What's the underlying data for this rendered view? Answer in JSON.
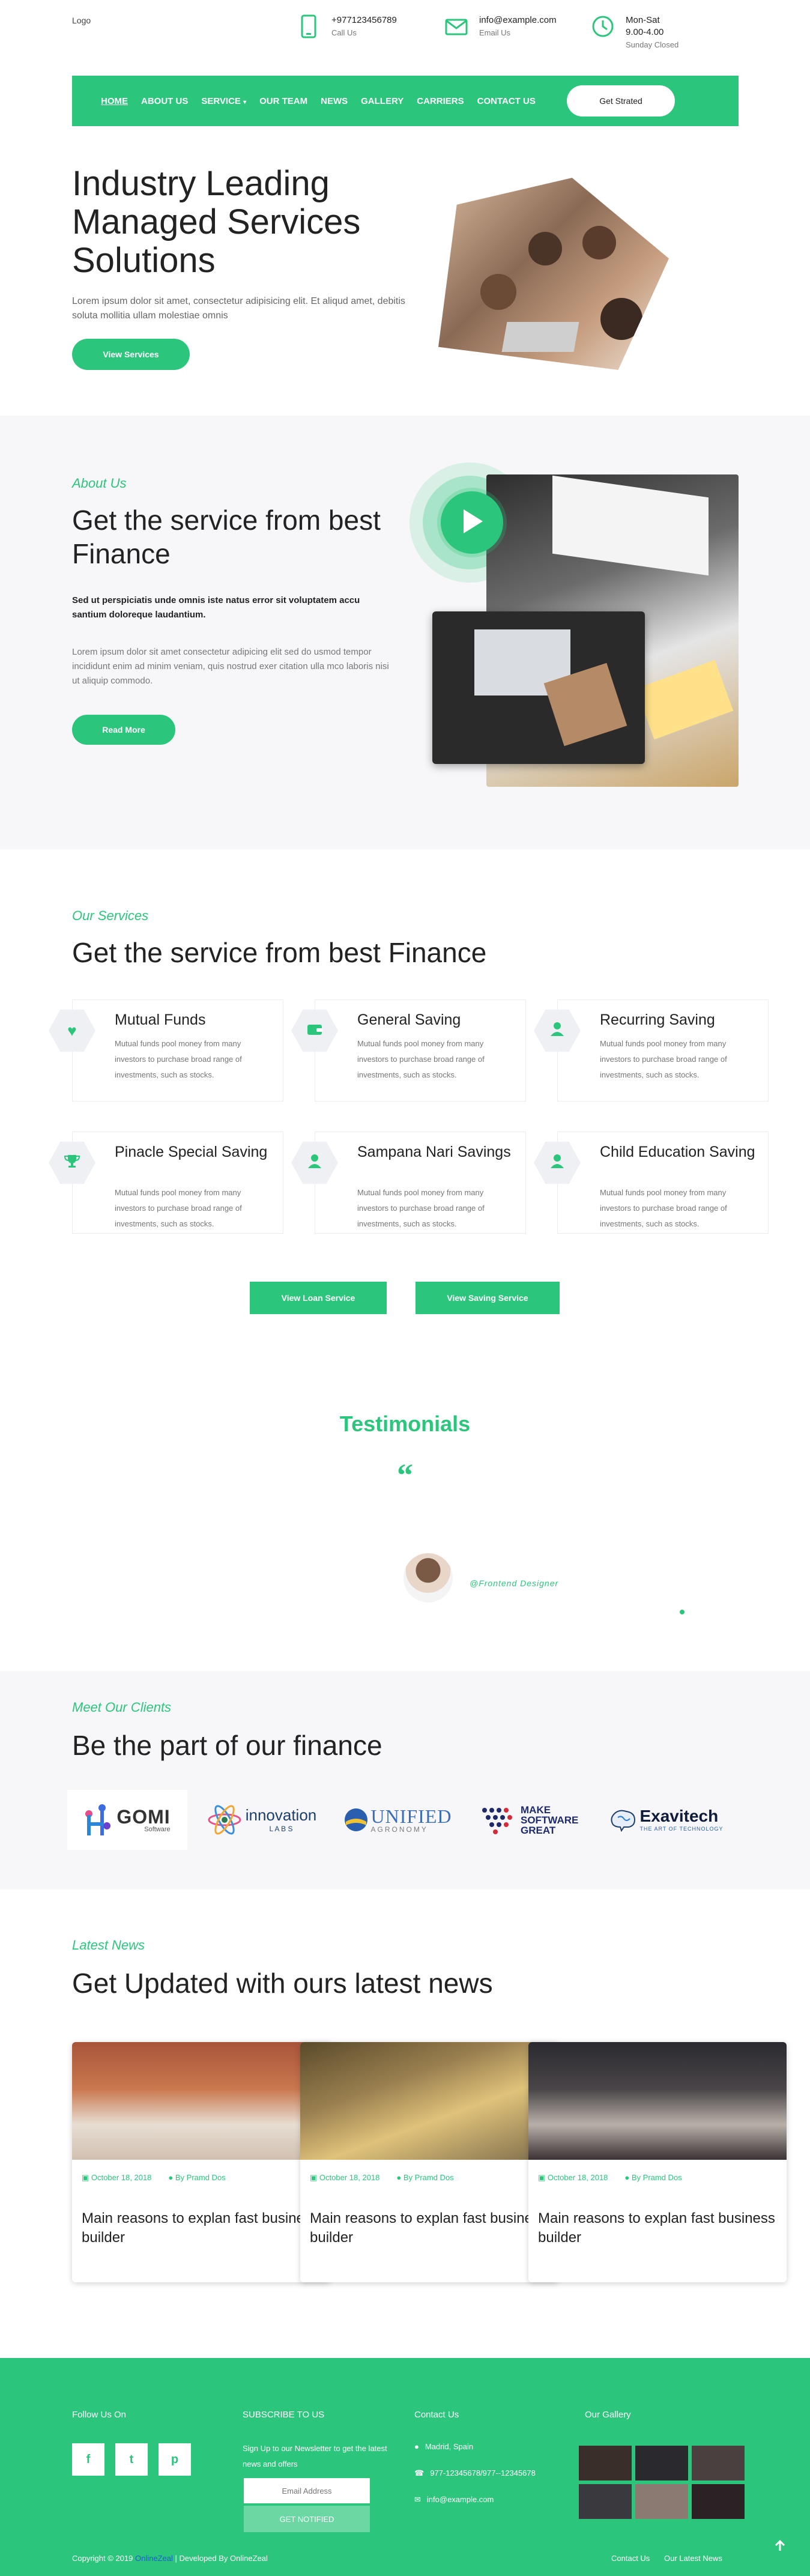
{
  "header": {
    "logo": "Logo",
    "phone": {
      "value": "+977123456789",
      "label": "Call Us"
    },
    "email": {
      "value": "info@example.com",
      "label": "Email Us"
    },
    "hours": {
      "days": "Mon-Sat",
      "time": "9.00-4.00",
      "note": "Sunday Closed"
    }
  },
  "nav": {
    "items": [
      "HOME",
      "ABOUT US",
      "SERVICE",
      "OUR TEAM",
      "NEWS",
      "GALLERY",
      "CARRIERS",
      "CONTACT US"
    ],
    "cta": "Get Strated"
  },
  "hero": {
    "title": "Industry Leading Managed Services Solutions",
    "text": "Lorem ipsum dolor sit amet, consectetur adipisicing elit. Et aliqud amet, debitis soluta mollitia ullam molestiae omnis",
    "button": "View Services"
  },
  "about": {
    "eyebrow": "About Us",
    "title": "Get the service from best Finance",
    "bold_text": "Sed ut perspiciatis unde omnis iste natus error sit voluptatem accu santium doloreque laudantium.",
    "text": "Lorem ipsum dolor sit amet consectetur adipicing elit sed do usmod tempor incididunt enim ad minim veniam, quis nostrud exer citation ulla mco laboris nisi ut aliquip commodo.",
    "button": "Read More"
  },
  "services": {
    "eyebrow": "Our Services",
    "title": "Get the service from best Finance",
    "items": [
      {
        "title": "Mutual Funds",
        "desc": "Mutual funds pool money from many investors to purchase broad range of investments, such as stocks.",
        "icon": "heart-icon"
      },
      {
        "title": "General Saving",
        "desc": "Mutual funds pool money from many investors to purchase broad range of investments, such as stocks.",
        "icon": "wallet-icon"
      },
      {
        "title": "Recurring Saving",
        "desc": "Mutual funds pool money from many investors to purchase broad range of investments, such as stocks.",
        "icon": "user-icon"
      },
      {
        "title": "Pinacle Special Saving",
        "desc": "Mutual funds pool money from many investors to purchase broad range of investments, such as stocks.",
        "icon": "trophy-icon"
      },
      {
        "title": "Sampana Nari Savings",
        "desc": "Mutual funds pool money from many investors to purchase broad range of investments, such as stocks.",
        "icon": "user-icon"
      },
      {
        "title": "Child Education Saving",
        "desc": "Mutual funds pool money from many investors to purchase broad range of investments, such as stocks.",
        "icon": "user-icon"
      }
    ],
    "btn_loan": "View Loan Service",
    "btn_saving": "View Saving Service"
  },
  "testimonials": {
    "title": "Testimonials",
    "quote_mark": "“",
    "role": "@Frontend Designer"
  },
  "clients": {
    "eyebrow": "Meet Our Clients",
    "title": "Be the part of our finance",
    "logos": [
      {
        "name": "GOMI",
        "sub": "Software"
      },
      {
        "name": "innovation",
        "sub": "L A B S"
      },
      {
        "name": "UNIFIED",
        "sub": "AGRONOMY"
      },
      {
        "name": "MAKE SOFTWARE GREAT",
        "sub": ""
      },
      {
        "name": "Exavitech",
        "sub": "THE ART OF TECHNOLOGY"
      }
    ]
  },
  "news": {
    "eyebrow": "Latest News",
    "title": "Get Updated with ours latest news",
    "items": [
      {
        "date": "October 18, 2018",
        "author": "By Pramd Dos",
        "title": "Main reasons to explan fast business builder"
      },
      {
        "date": "October 18, 2018",
        "author": "By Pramd Dos",
        "title": "Main reasons to explan fast business builder"
      },
      {
        "date": "October 18, 2018",
        "author": "By Pramd Dos",
        "title": "Main reasons to explan fast business builder"
      }
    ]
  },
  "footer": {
    "follow": "Follow Us On",
    "social": [
      "f",
      "t",
      "p"
    ],
    "subscribe_title": "SUBSCRIBE TO US",
    "subscribe_text": "Sign Up to our Newsletter to get the latest news and offers",
    "email_placeholder": "Email Address",
    "subscribe_btn": "GET NOTIFIED",
    "contact_title": "Contact Us",
    "address": "Madrid, Spain",
    "phones": "977-12345678/977--12345678",
    "email": "info@example.com",
    "gallery_title": "Our Gallery",
    "copyright_pre": "Copyright © 2019",
    "copyright_link": "OnlineZeal",
    "copyright_post": "| Developed By OnlineZeal",
    "links": [
      "Contact Us",
      "Our Latest News"
    ]
  },
  "colors": {
    "accent": "#2bc67c",
    "light_bg": "#f7f7fa"
  }
}
